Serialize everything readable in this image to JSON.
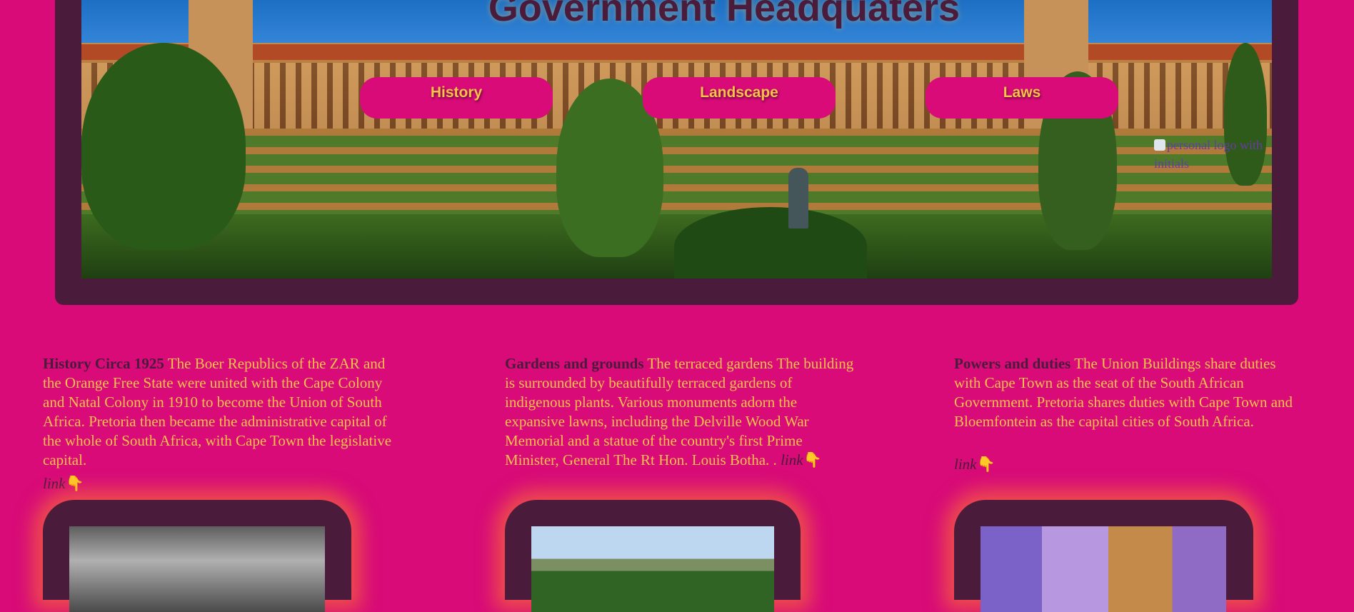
{
  "header": {
    "title": "Government Headquaters",
    "nav": [
      "History",
      "Landscape",
      "Laws"
    ],
    "logo_alt": "personal logo with initials"
  },
  "sections": [
    {
      "heading": "History Circa 1925",
      "text": "The Boer Republics of the ZAR and the Orange Free State were united with the Cape Colony and Natal Colony in 1910 to become the Union of South Africa. Pretoria then became the administrative capital of the whole of South Africa, with Cape Town the legislative capital.",
      "link": "link"
    },
    {
      "heading": "Gardens and grounds",
      "text": "The terraced gardens The building is surrounded by beautifully terraced gardens of indigenous plants. Various monuments adorn the expansive lawns, including the Delville Wood War Memorial and a statue of the country's first Prime Minister, General The Rt Hon. Louis Botha. .",
      "link": "link"
    },
    {
      "heading": "Powers and duties",
      "text": "The Union Buildings share duties with Cape Town as the seat of the South African Government. Pretoria shares duties with Cape Town and Bloemfontein as the capital cities of South Africa.",
      "link": "link"
    }
  ],
  "pointer_glyph": "👇",
  "colors": {
    "background": "#d80b78",
    "panel": "#4a1b3a",
    "text": "#f7c24a"
  }
}
